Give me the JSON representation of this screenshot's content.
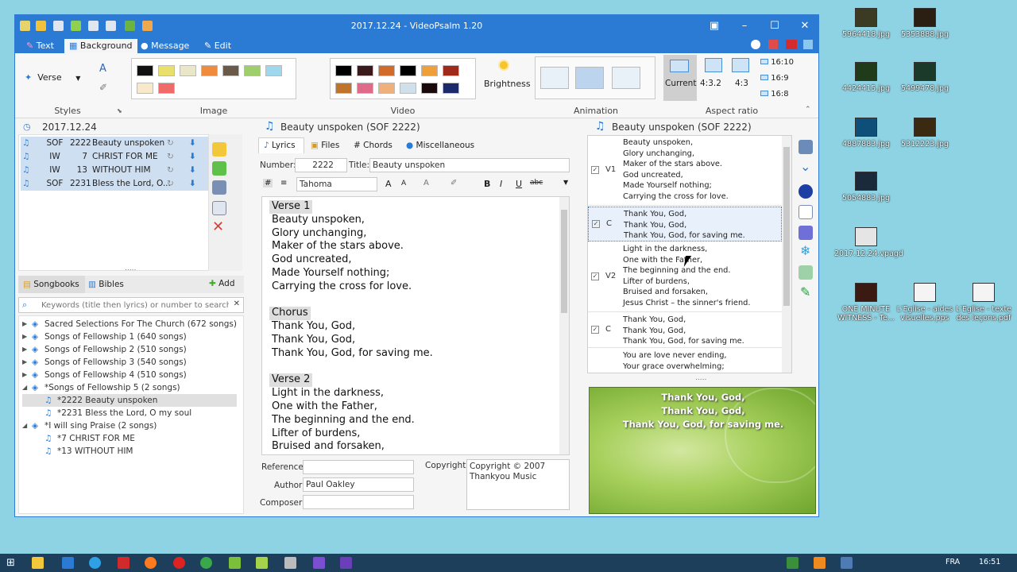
{
  "window": {
    "title": "2017.12.24 - VideoPsalm 1.20"
  },
  "tabs": [
    "Text",
    "Background",
    "Message",
    "Edit"
  ],
  "ribbon": {
    "verse_label": "Verse",
    "groups": [
      "Styles",
      "Image",
      "Video",
      "Animation",
      "Aspect ratio"
    ],
    "brightness_label": "Brightness",
    "aspect_options": [
      "Current",
      "4:3.2",
      "4:3"
    ],
    "aspect_small": [
      "16:10",
      "16:9",
      "16:8"
    ]
  },
  "schedule": {
    "date": "2017.12.24",
    "rows": [
      {
        "book": "SOF",
        "num": "2222",
        "title": "Beauty unspoken"
      },
      {
        "book": "IW",
        "num": "7",
        "title": "CHRIST FOR ME"
      },
      {
        "book": "IW",
        "num": "13",
        "title": "WITHOUT HIM"
      },
      {
        "book": "SOF",
        "num": "2231",
        "title": "Bless the Lord, O..."
      }
    ],
    "splitter": "....."
  },
  "library": {
    "tab_songbooks": "Songbooks",
    "tab_bibles": "Bibles",
    "add_label": "Add",
    "search_placeholder": "Keywords (title then lyrics) or number to search",
    "tree": [
      {
        "label": "Sacred Selections For The Church (672 songs)",
        "level": 0,
        "open": false
      },
      {
        "label": "Songs of Fellowship 1 (640 songs)",
        "level": 0,
        "open": false
      },
      {
        "label": "Songs of Fellowship 2 (510 songs)",
        "level": 0,
        "open": false
      },
      {
        "label": "Songs of Fellowship 3 (540 songs)",
        "level": 0,
        "open": false
      },
      {
        "label": "Songs of Fellowship 4 (510 songs)",
        "level": 0,
        "open": false
      },
      {
        "label": "*Songs of Fellowship 5 (2 songs)",
        "level": 0,
        "open": true
      },
      {
        "label": "*2222  Beauty unspoken",
        "level": 1,
        "sel": true
      },
      {
        "label": "*2231  Bless the Lord, O my soul",
        "level": 1
      },
      {
        "label": "*I will sing Praise (2 songs)",
        "level": 0,
        "open": true
      },
      {
        "label": "*7  CHRIST FOR ME",
        "level": 1
      },
      {
        "label": "*13  WITHOUT HIM",
        "level": 1
      }
    ]
  },
  "editor": {
    "title": "Beauty unspoken (SOF 2222)",
    "tabs": [
      "Lyrics",
      "Files",
      "Chords",
      "Miscellaneous"
    ],
    "number_label": "Number:",
    "number_value": "2222",
    "title_label": "Title:",
    "title_value": "Beauty unspoken",
    "font": "Tahoma",
    "lyrics": [
      {
        "t": "Verse 1",
        "h": true
      },
      {
        "t": "Beauty unspoken,"
      },
      {
        "t": "Glory unchanging,"
      },
      {
        "t": "Maker of the stars above."
      },
      {
        "t": "God uncreated,"
      },
      {
        "t": "Made Yourself nothing;"
      },
      {
        "t": "Carrying the cross for love."
      },
      {
        "t": ""
      },
      {
        "t": "Chorus",
        "h": true
      },
      {
        "t": "Thank You, God,"
      },
      {
        "t": "Thank You, God,"
      },
      {
        "t": "Thank You, God, for saving me."
      },
      {
        "t": ""
      },
      {
        "t": "Verse 2",
        "h": true
      },
      {
        "t": "Light in the darkness,"
      },
      {
        "t": "One with the Father,"
      },
      {
        "t": "The beginning and the end."
      },
      {
        "t": "Lifter of burdens,"
      },
      {
        "t": "Bruised and forsaken,"
      }
    ],
    "reference_label": "Reference:",
    "author_label": "Author:",
    "author_value": "Paul Oakley",
    "composer_label": "Composer:",
    "copyright_label": "Copyright:",
    "copyright_value": "Copyright © 2007\nThankyou Music"
  },
  "preview": {
    "title": "Beauty unspoken (SOF 2222)",
    "slides": [
      {
        "tag": "V1",
        "text": "Beauty unspoken,\nGlory unchanging,\nMaker of the stars above.\nGod uncreated,\nMade Yourself nothing;\nCarrying the cross for love.",
        "checked": true
      },
      {
        "tag": "C",
        "text": "Thank You, God,\nThank You, God,\nThank You, God, for saving me.",
        "checked": true,
        "sel": true
      },
      {
        "tag": "V2",
        "text": "Light in the darkness,\nOne with the Father,\nThe beginning and the end.\nLifter of burdens,\nBruised and forsaken,\nJesus Christ – the sinner's friend.",
        "checked": true
      },
      {
        "tag": "C",
        "text": "Thank You, God,\nThank You, God,\nThank You, God, for saving me.",
        "checked": true
      },
      {
        "tag": "",
        "text": "You are love never ending,\nYour grace overwhelming;\nCrucified for me",
        "checked": false
      }
    ],
    "screen_lines": [
      "Thank You, God,",
      "Thank You, God,",
      "Thank You, God, for saving me."
    ]
  },
  "desktop": {
    "icons": [
      "5964418.jpg",
      "5353888.jpg",
      "4424415.jpg",
      "5499478.jpg",
      "4887883.jpg",
      "5312223.jpg",
      "5054883.jpg",
      "2017.12.24.vpagd",
      "ONE MINUTE WITNESS - Te...",
      "L'Eglise - aides visuelles.pps",
      "L'Eglise - texte des leçons.pdf"
    ]
  },
  "taskbar": {
    "lang": "FRA",
    "time": "16:51"
  },
  "colors": {
    "accent": "#2b7ad3",
    "taskbar": "#1d3f5c",
    "desktop": "#8ed3e3"
  }
}
